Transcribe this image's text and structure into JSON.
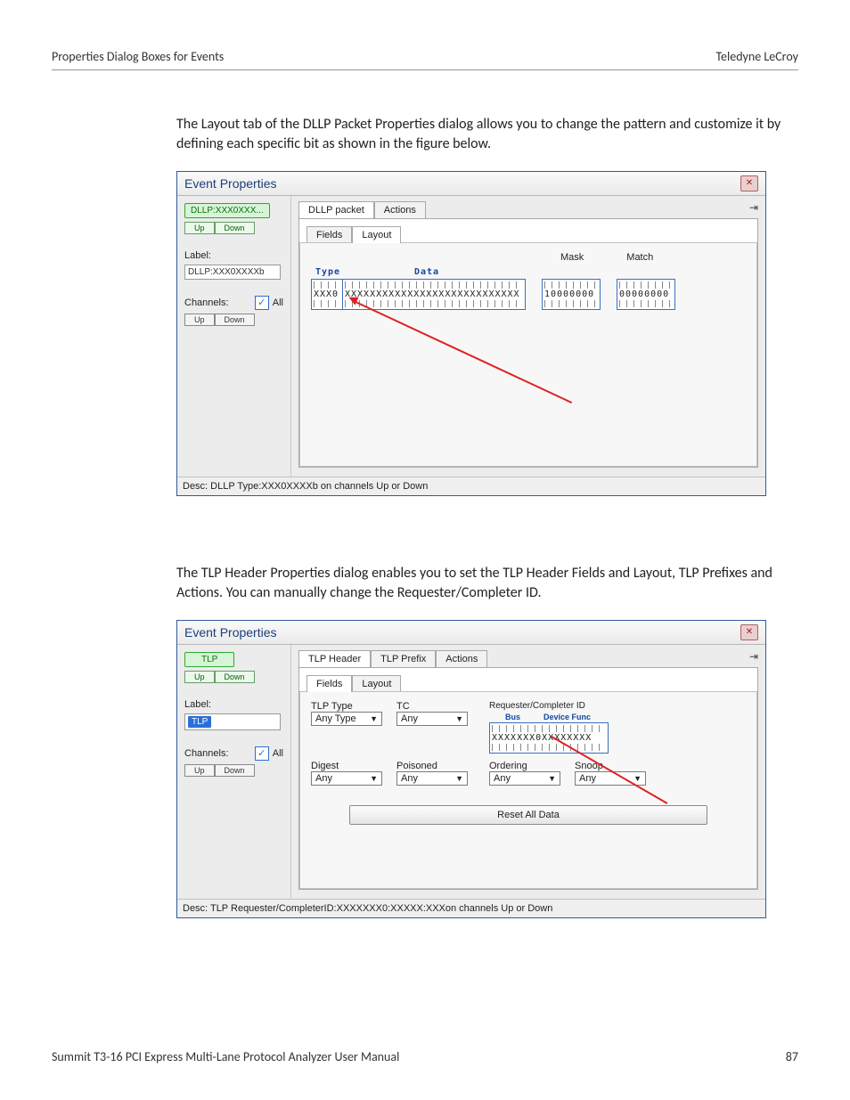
{
  "header": {
    "left": "Properties Dialog Boxes for Events",
    "right": "Teledyne LeCroy"
  },
  "para1": "The Layout tab of the DLLP Packet Properties dialog allows you to change the pattern and customize it by defining each specific bit as shown in the figure below.",
  "dlg1": {
    "title": "Event Properties",
    "badge": "DLLP:XXX0XXX...",
    "up": "Up",
    "down": "Down",
    "label_header": "Label:",
    "label_value": "DLLP:XXX0XXXXb",
    "channels_header": "Channels:",
    "all": "All",
    "tab_packet": "DLLP packet",
    "tab_actions": "Actions",
    "subtab_fields": "Fields",
    "subtab_layout": "Layout",
    "col_mask": "Mask",
    "col_match": "Match",
    "seg_type_caption": "Type",
    "seg_data_caption": "Data",
    "seg_type_val": "XXX0",
    "seg_data_val": "XXXXXXXXXXXXXXXXXXXXXXXXXXXX",
    "mask_val": "10000000",
    "match_val": "00000000",
    "desc": "Desc: DLLP Type:XXX0XXXXb on channels Up or Down"
  },
  "para2": "The TLP Header Properties dialog enables you to set the TLP Header Fields and Layout, TLP Prefixes and Actions. You can manually change the Requester/Completer ID.",
  "dlg2": {
    "title": "Event Properties",
    "badge": "TLP",
    "up": "Up",
    "down": "Down",
    "label_header": "Label:",
    "label_value": "TLP",
    "channels_header": "Channels:",
    "all": "All",
    "tab_header": "TLP Header",
    "tab_prefix": "TLP Prefix",
    "tab_actions": "Actions",
    "subtab_fields": "Fields",
    "subtab_layout": "Layout",
    "f_tlptype": "TLP Type",
    "v_tlptype": "Any Type",
    "f_tc": "TC",
    "v_tc": "Any",
    "reqcomp_title": "Requester/Completer ID",
    "reg_bus": "Bus",
    "reg_devfunc": "Device  Func",
    "reg_val": "XXXXXXX0XXXXXXXX",
    "f_digest": "Digest",
    "v_digest": "Any",
    "f_poisoned": "Poisoned",
    "v_poisoned": "Any",
    "f_ordering": "Ordering",
    "v_ordering": "Any",
    "f_snoop": "Snoop",
    "v_snoop": "Any",
    "reset_btn": "Reset All Data",
    "desc": "Desc: TLP Requester/CompleterID:XXXXXXX0:XXXXX:XXXon channels Up or Down"
  },
  "footer": {
    "left": "Summit T3-16 PCI Express Multi-Lane Protocol Analyzer User Manual",
    "right": "87"
  }
}
